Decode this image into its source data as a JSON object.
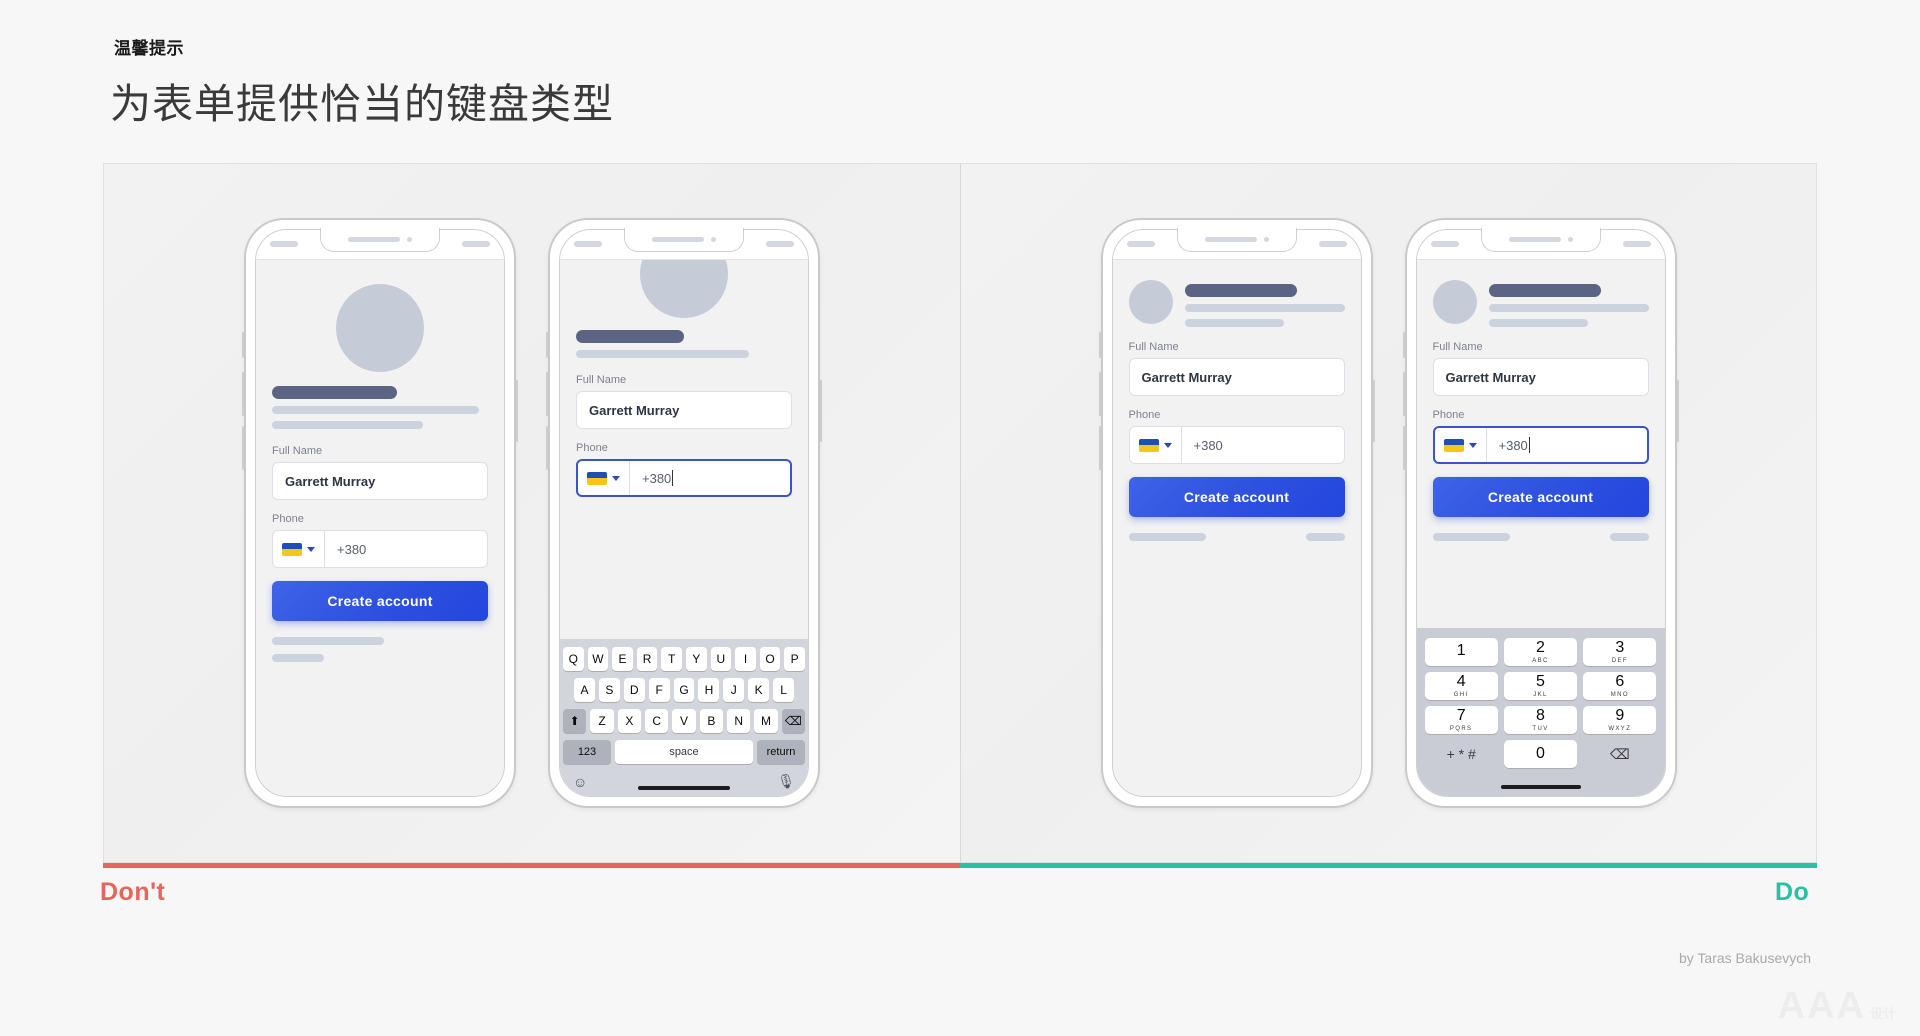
{
  "header": {
    "kicker": "温馨提示",
    "headline": "为表单提供恰当的键盘类型"
  },
  "verdict": {
    "dont": "Don't",
    "do": "Do"
  },
  "credit": "by Taras Bakusevych",
  "watermark": {
    "text": "AAA",
    "suffix": "设计"
  },
  "form": {
    "full_name_label": "Full Name",
    "full_name_value": "Garrett Murray",
    "phone_label": "Phone",
    "phone_value": "+380",
    "submit_label": "Create account",
    "flag_name": "ukraine-flag-icon"
  },
  "keyboard": {
    "row1": [
      "Q",
      "W",
      "E",
      "R",
      "T",
      "Y",
      "U",
      "I",
      "O",
      "P"
    ],
    "row2": [
      "A",
      "S",
      "D",
      "F",
      "G",
      "H",
      "J",
      "K",
      "L"
    ],
    "row3": [
      "Z",
      "X",
      "C",
      "V",
      "B",
      "N",
      "M"
    ],
    "shift": "⬆",
    "backspace": "⌫",
    "numbers": "123",
    "space": "space",
    "return": "return",
    "emoji": "☺",
    "mic": "🎙"
  },
  "numpad": {
    "keys": [
      {
        "n": "1",
        "sub": ""
      },
      {
        "n": "2",
        "sub": "ABC"
      },
      {
        "n": "3",
        "sub": "DEF"
      },
      {
        "n": "4",
        "sub": "GHI"
      },
      {
        "n": "5",
        "sub": "JKL"
      },
      {
        "n": "6",
        "sub": "MNO"
      },
      {
        "n": "7",
        "sub": "PQRS"
      },
      {
        "n": "8",
        "sub": "TUV"
      },
      {
        "n": "9",
        "sub": "WXYZ"
      }
    ],
    "symbols": "+ * #",
    "zero": "0",
    "backspace": "⌫"
  },
  "colors": {
    "accent_blue": "#2f51e0",
    "dont_red": "#e8645c",
    "do_green": "#2bbfa4",
    "placeholder_dark": "#5b6483",
    "placeholder_light": "#ccd2de"
  }
}
